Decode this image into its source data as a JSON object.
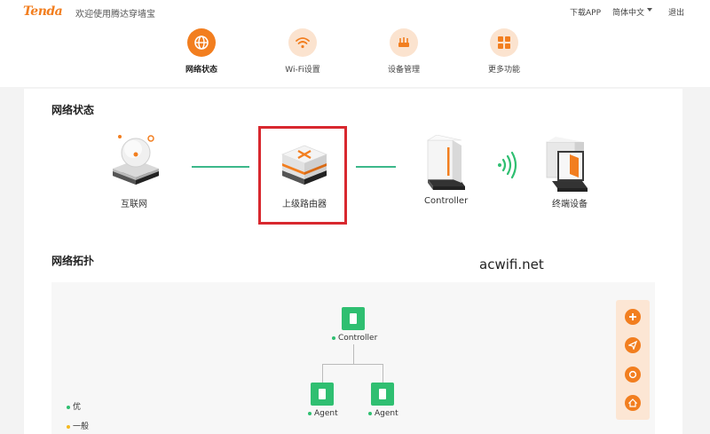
{
  "header": {
    "logo": "Tenda",
    "welcome": "欢迎使用腾达穿墙宝",
    "download_app": "下载APP",
    "language": "简体中文",
    "logout": "退出"
  },
  "nav": [
    {
      "label": "网络状态",
      "icon": "globe-icon"
    },
    {
      "label": "Wi-Fi设置",
      "icon": "wifi-icon"
    },
    {
      "label": "设备管理",
      "icon": "router-icon"
    },
    {
      "label": "更多功能",
      "icon": "grid-icon"
    }
  ],
  "status": {
    "title": "网络状态",
    "devices": [
      "互联网",
      "上级路由器",
      "Controller",
      "终端设备"
    ]
  },
  "watermark": "acwifi.net",
  "topology": {
    "title": "网络拓扑",
    "controller": "Controller",
    "agents": [
      "Agent",
      "Agent"
    ],
    "legend": [
      {
        "label": "优",
        "color": "#2fbf71"
      },
      {
        "label": "一般",
        "color": "#f5b921"
      }
    ]
  },
  "colors": {
    "accent": "#f27e1f",
    "node": "#2fbf71",
    "link": "#3cb88a",
    "highlight": "#d8282f"
  }
}
